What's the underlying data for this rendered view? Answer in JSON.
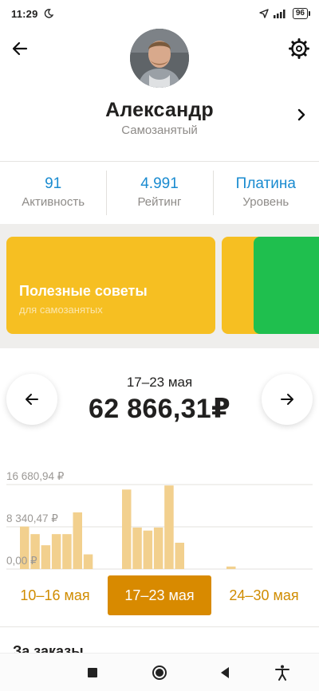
{
  "status_bar": {
    "time": "11:29",
    "battery": "96"
  },
  "profile": {
    "name": "Александр",
    "status": "Самозанятый"
  },
  "stats": [
    {
      "value": "91",
      "label": "Активность"
    },
    {
      "value": "4.991",
      "label": "Рейтинг"
    },
    {
      "value": "Платина",
      "label": "Уровень"
    }
  ],
  "promo": {
    "title": "Полезные советы",
    "subtitle": "для самозанятых"
  },
  "earnings": {
    "range": "17–23 мая",
    "total": "62 866,31₽"
  },
  "chart_data": {
    "type": "bar",
    "ylim": [
      0,
      16680.94
    ],
    "ticks": [
      "16 680,94 ₽",
      "8 340,47 ₽",
      "0,00 ₽"
    ],
    "tick_values": [
      16680.94,
      8340.47,
      0
    ],
    "groups": [
      {
        "name": "10–16 мая",
        "values": [
          8400,
          6900,
          4700,
          6900,
          6900,
          11200,
          2900
        ]
      },
      {
        "name": "17–23 мая",
        "values": [
          15700,
          8200,
          7600,
          8200,
          16500,
          5200
        ]
      },
      {
        "name": "24–30 мая",
        "values": [
          500
        ]
      }
    ],
    "bar_color": "#f2d08e",
    "grid": true
  },
  "week_tabs": [
    {
      "label": "10–16 мая",
      "active": false
    },
    {
      "label": "17–23 мая",
      "active": true
    },
    {
      "label": "24–30 мая",
      "active": false
    }
  ],
  "section": {
    "heading": "За заказы"
  },
  "colors": {
    "accent_blue": "#1a8bd0",
    "promo_yellow": "#f6bf22",
    "promo_green": "#1fbf4e",
    "active_tab": "#d88a00",
    "tab_text": "#d08c00"
  }
}
